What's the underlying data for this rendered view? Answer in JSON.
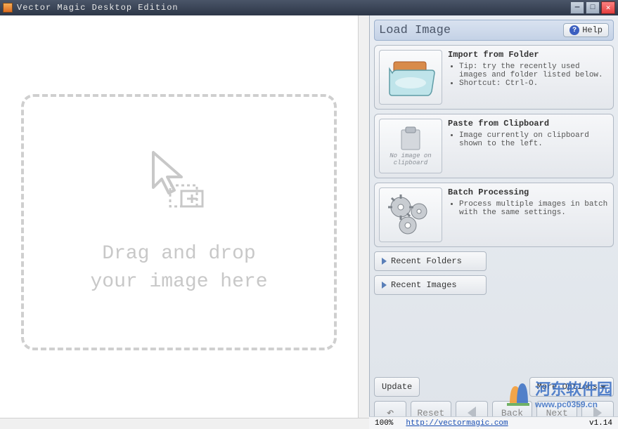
{
  "titlebar": {
    "app_name": "Vector Magic Desktop Edition"
  },
  "drop": {
    "line1": "Drag and drop",
    "line2": "your image here"
  },
  "panel": {
    "title": "Load Image",
    "help_label": "Help"
  },
  "cards": {
    "import": {
      "title": "Import from Folder",
      "tip": "Tip: try the recently used images and folder listed below.",
      "shortcut": "Shortcut: Ctrl-O."
    },
    "paste": {
      "title": "Paste from Clipboard",
      "thumb_text": "No image on clipboard",
      "desc": "Image currently on clipboard shown to the left."
    },
    "batch": {
      "title": "Batch Processing",
      "desc": "Process multiple images in batch with the same settings."
    }
  },
  "recent": {
    "folders": "Recent Folders",
    "images": "Recent Images"
  },
  "bottom": {
    "update": "Update",
    "more": "More Options",
    "reset": "Reset",
    "back": "Back",
    "next": "Next"
  },
  "status": {
    "zoom": "100%",
    "url": "http://vectormagic.com",
    "version": "v1.14"
  },
  "watermark": {
    "text": "河东软件园",
    "url": "www.pc0359.cn"
  }
}
